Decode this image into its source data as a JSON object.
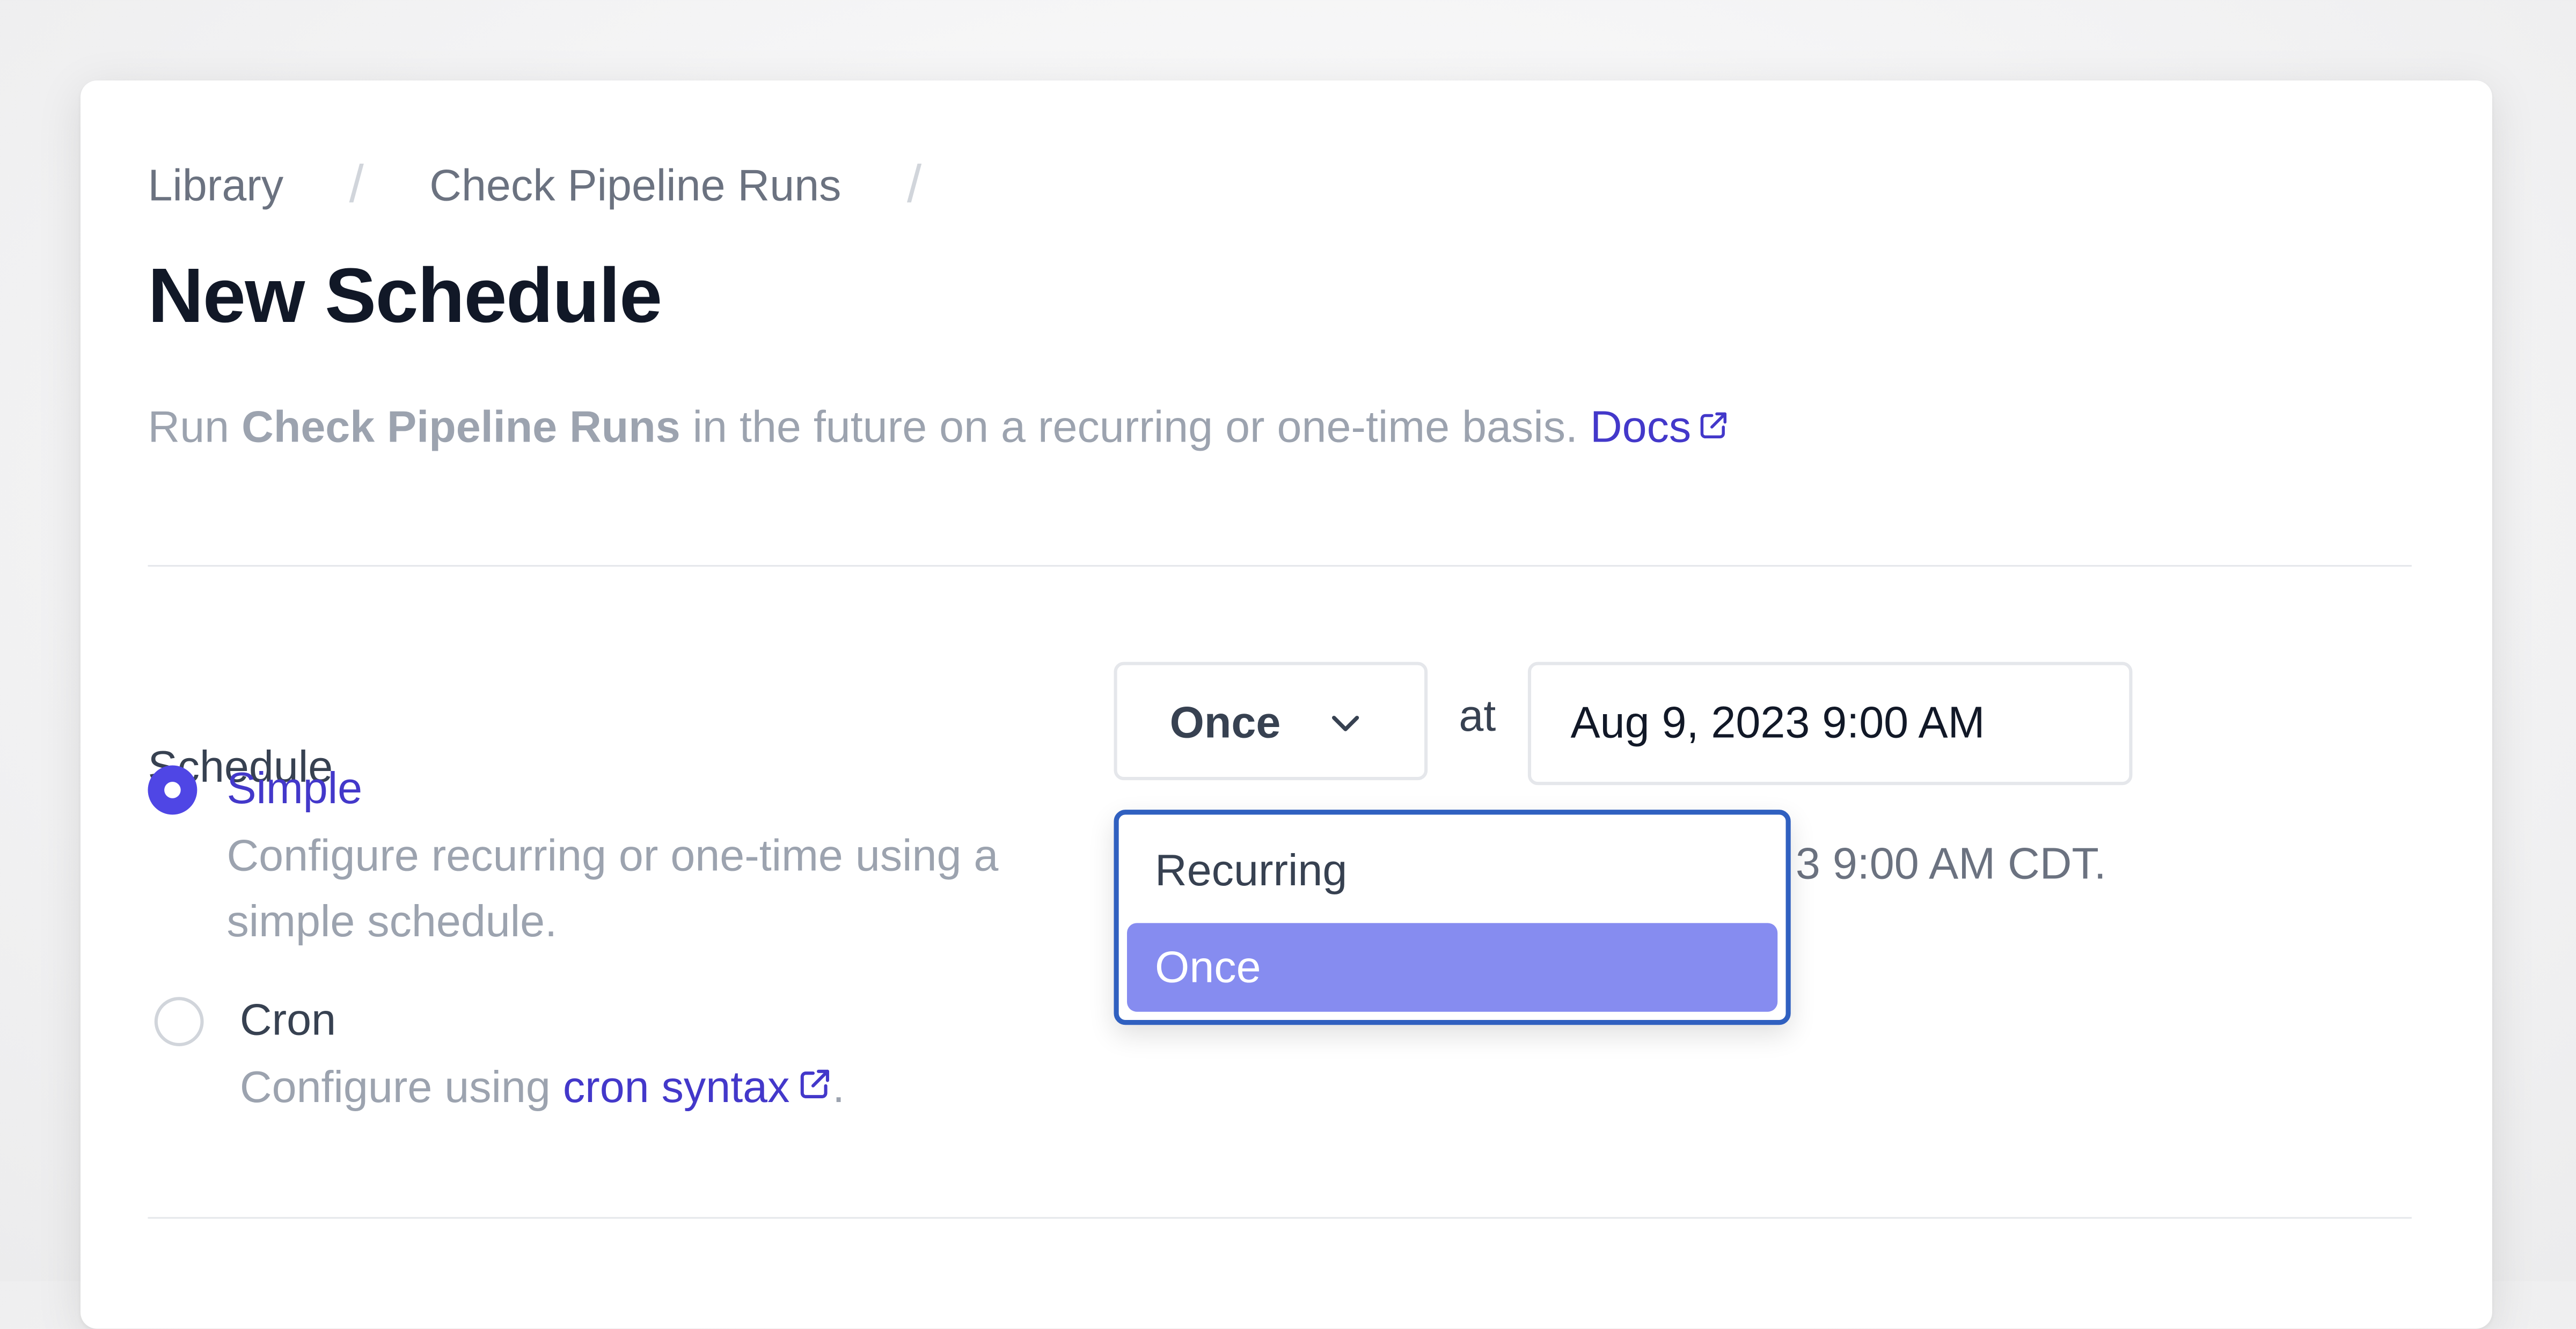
{
  "breadcrumb": {
    "items": [
      "Library",
      "Check Pipeline Runs"
    ],
    "separator": "/"
  },
  "page": {
    "title": "New Schedule",
    "description_prefix": "Run ",
    "description_bold": "Check Pipeline Runs",
    "description_suffix": " in the future on a recurring or one-time basis. ",
    "docs_link": "Docs"
  },
  "schedule": {
    "label": "Schedule",
    "options": [
      {
        "title": "Simple",
        "description": "Configure recurring or one-time using a simple schedule.",
        "selected": true
      },
      {
        "title": "Cron",
        "description_prefix": "Configure using ",
        "link": "cron syntax",
        "description_suffix": ".",
        "selected": false
      }
    ]
  },
  "frequency": {
    "selected": "Once",
    "at_label": "at",
    "datetime_value": "Aug 9, 2023 9:00 AM",
    "hint_visible": "3 9:00 AM CDT.",
    "dropdown_options": [
      "Recurring",
      "Once"
    ],
    "dropdown_highlighted": "Once"
  },
  "icons": {
    "external_link": "external-link-icon",
    "chevron": "chevron-down-icon"
  },
  "colors": {
    "accent": "#4f46e5",
    "link": "#4338ca",
    "highlight": "#868cf0",
    "focus_border": "#3060c0",
    "title": "#111827"
  }
}
